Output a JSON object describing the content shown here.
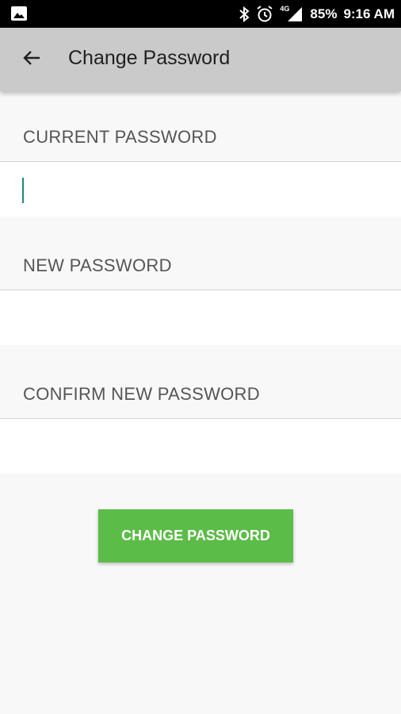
{
  "status_bar": {
    "battery": "85%",
    "time": "9:16 AM",
    "network": "4G",
    "icons": [
      "image-icon",
      "bluetooth-icon",
      "alarm-icon",
      "signal-icon",
      "battery-indicator"
    ]
  },
  "app_bar": {
    "title": "Change Password",
    "back_icon": "arrow-back-icon"
  },
  "form": {
    "current_password_label": "CURRENT PASSWORD",
    "current_password_value": "",
    "new_password_label": "NEW PASSWORD",
    "new_password_value": "",
    "confirm_password_label": "CONFIRM NEW PASSWORD",
    "confirm_password_value": "",
    "submit_label": "CHANGE PASSWORD"
  },
  "colors": {
    "status_bar": "#000000",
    "app_bar": "#cacaca",
    "accent_button": "#5bbc48",
    "cursor": "#1a8a73",
    "background": "#f8f8f8"
  }
}
